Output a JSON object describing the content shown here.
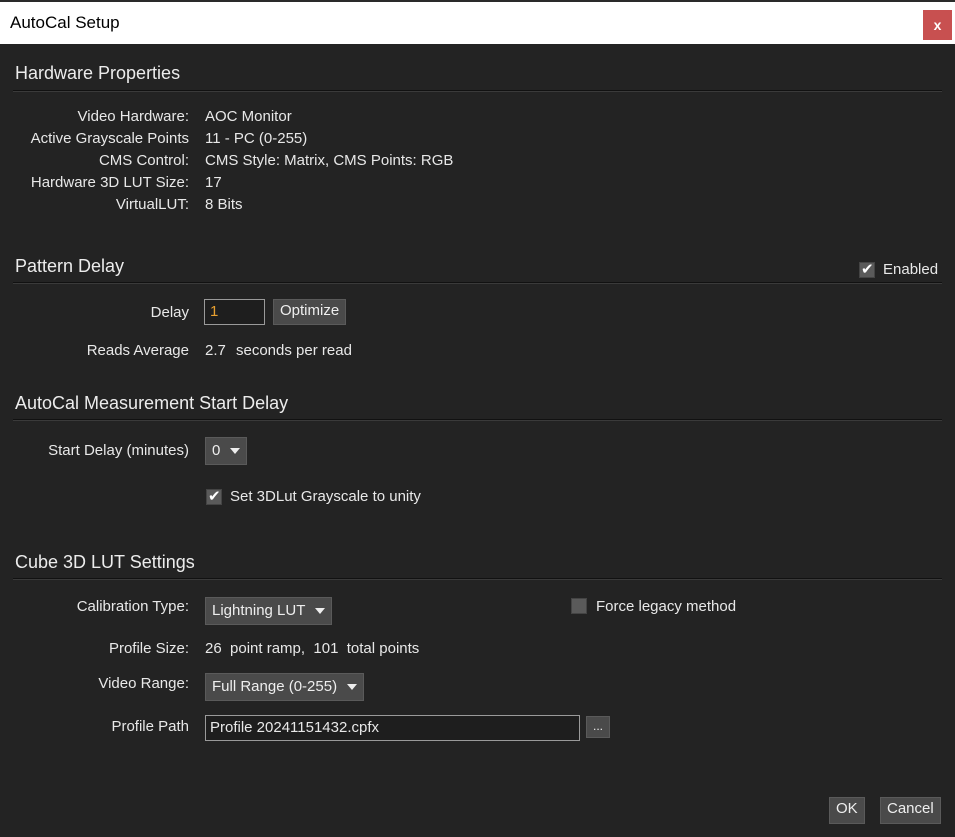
{
  "window": {
    "title": "AutoCal Setup",
    "close": "x"
  },
  "hardware": {
    "title": "Hardware Properties",
    "rows": [
      {
        "label": "Video Hardware:",
        "value": "AOC Monitor"
      },
      {
        "label": "Active Grayscale Points",
        "value": "11 - PC (0-255)"
      },
      {
        "label": "CMS Control:",
        "value": "CMS Style: Matrix, CMS Points: RGB"
      },
      {
        "label": "Hardware 3D LUT Size:",
        "value": "17"
      },
      {
        "label": "VirtualLUT:",
        "value": "8 Bits"
      }
    ]
  },
  "pattern": {
    "title": "Pattern Delay",
    "enabled_label": "Enabled",
    "enabled": true,
    "delay_label": "Delay",
    "delay_value": "1",
    "optimize": "Optimize",
    "reads_label": "Reads Average",
    "reads_value": "2.7",
    "reads_unit": "seconds per read"
  },
  "start": {
    "title": "AutoCal Measurement Start Delay",
    "label": "Start Delay (minutes)",
    "value": "0",
    "unity_label": "Set 3DLut Grayscale to unity",
    "unity": true
  },
  "cube": {
    "title": "Cube 3D LUT Settings",
    "cal_label": "Calibration Type:",
    "cal_value": "Lightning LUT",
    "legacy_label": "Force legacy method",
    "legacy": false,
    "size_label": "Profile Size:",
    "size_value": "26  point ramp,  101  total points",
    "range_label": "Video Range:",
    "range_value": "Full Range (0-255)",
    "path_label": "Profile Path",
    "path_value": "Profile 20241151432.cpfx",
    "browse": "..."
  },
  "footer": {
    "ok": "OK",
    "cancel": "Cancel"
  }
}
